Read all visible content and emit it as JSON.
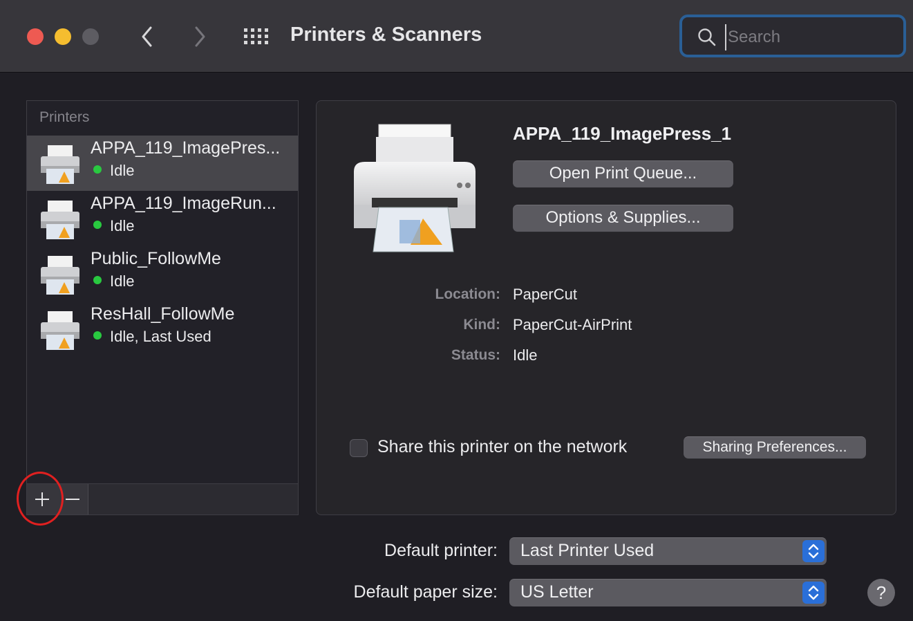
{
  "window": {
    "title": "Printers & Scanners",
    "search_placeholder": "Search"
  },
  "printer_list": {
    "header": "Printers",
    "items": [
      {
        "name": "APPA_119_ImagePres...",
        "status": "Idle",
        "selected": true
      },
      {
        "name": "APPA_119_ImageRun...",
        "status": "Idle",
        "selected": false
      },
      {
        "name": "Public_FollowMe",
        "status": "Idle",
        "selected": false
      },
      {
        "name": "ResHall_FollowMe",
        "status": "Idle, Last Used",
        "selected": false
      }
    ],
    "add_label": "+",
    "remove_label": "−"
  },
  "details": {
    "name": "APPA_119_ImagePress_1",
    "open_queue_label": "Open Print Queue...",
    "options_label": "Options & Supplies...",
    "location_label": "Location:",
    "location_value": "PaperCut",
    "kind_label": "Kind:",
    "kind_value": "PaperCut-AirPrint",
    "status_label": "Status:",
    "status_value": "Idle",
    "share_label": "Share this printer on the network",
    "share_checked": false,
    "sharing_prefs_label": "Sharing Preferences..."
  },
  "defaults": {
    "printer_label": "Default printer:",
    "printer_value": "Last Printer Used",
    "paper_label": "Default paper size:",
    "paper_value": "US Letter"
  },
  "help_label": "?",
  "colors": {
    "status_idle": "#29c940",
    "accent_blue": "#2a6fd8",
    "annotation_red": "#e02020"
  }
}
